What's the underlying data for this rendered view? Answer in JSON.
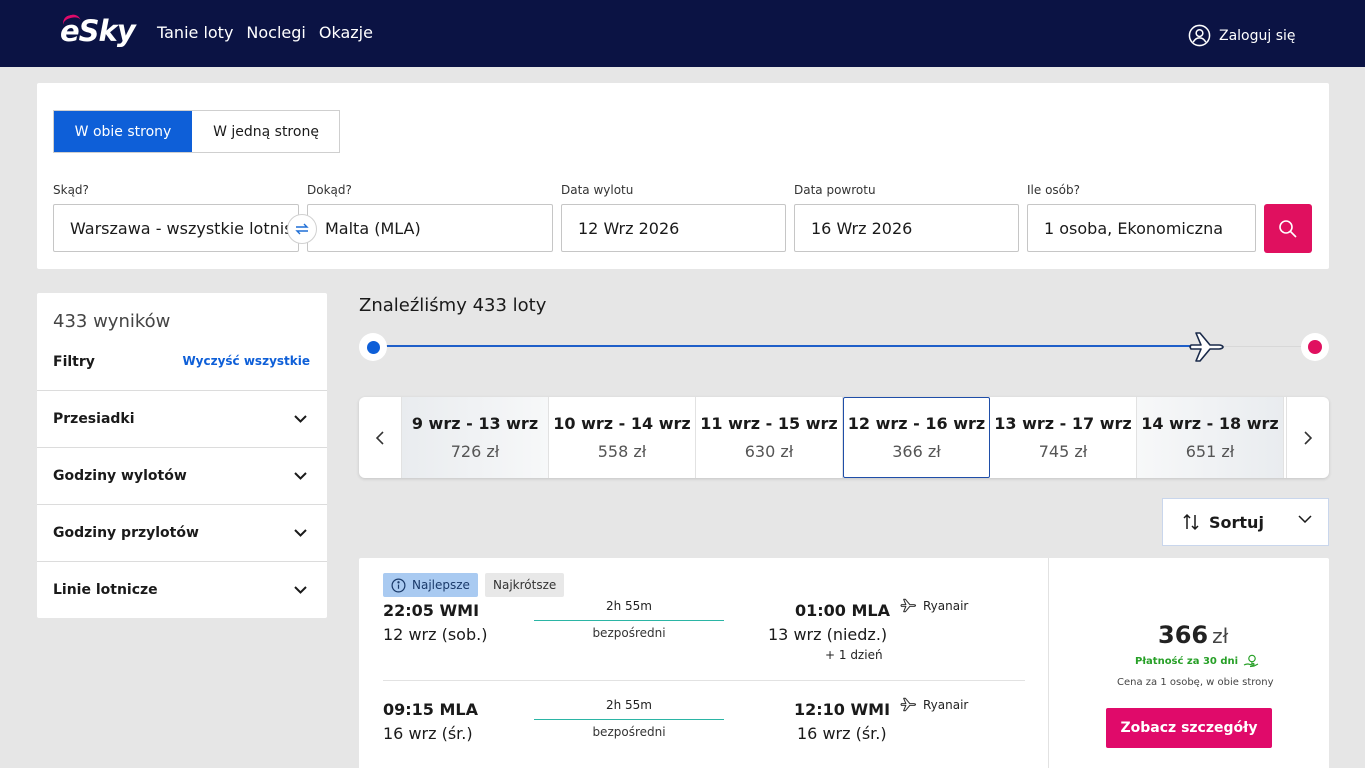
{
  "header": {
    "logo": "eSky",
    "nav": [
      "Tanie loty",
      "Noclegi",
      "Okazje"
    ],
    "login_label": "Zaloguj się"
  },
  "search": {
    "trip_type": {
      "round_trip": "W obie strony",
      "one_way": "W jedną stronę",
      "selected": "W obie strony"
    },
    "from": {
      "label": "Skąd?",
      "value": "Warszawa - wszystkie lotniska"
    },
    "to": {
      "label": "Dokąd?",
      "value": "Malta (MLA)"
    },
    "departure": {
      "label": "Data wylotu",
      "value": "12 Wrz 2026"
    },
    "return": {
      "label": "Data powrotu",
      "value": "16 Wrz 2026"
    },
    "passengers": {
      "label": "Ile osób?",
      "value": "1 osoba, Ekonomiczna"
    }
  },
  "filters": {
    "results_count": "433 wyników",
    "title": "Filtry",
    "clear_all": "Wyczyść wszystkie",
    "sections": [
      "Przesiadki",
      "Godziny wylotów",
      "Godziny przylotów",
      "Linie lotnicze"
    ]
  },
  "results": {
    "title": "Znaleźliśmy 433 loty",
    "date_options": [
      {
        "range": "9 wrz - 13 wrz",
        "price": "726 zł"
      },
      {
        "range": "10 wrz - 14 wrz",
        "price": "558 zł"
      },
      {
        "range": "11 wrz - 15 wrz",
        "price": "630 zł"
      },
      {
        "range": "12 wrz - 16 wrz",
        "price": "366 zł",
        "selected": true
      },
      {
        "range": "13 wrz - 17 wrz",
        "price": "745 zł"
      },
      {
        "range": "14 wrz - 18 wrz",
        "price": "651 zł"
      }
    ],
    "sort_label": "Sortuj"
  },
  "flight": {
    "badges": {
      "best": "Najlepsze",
      "shortest": "Najkrótsze"
    },
    "outbound": {
      "dep_time": "22:05 WMI",
      "dep_date": "12 wrz (sob.)",
      "duration": "2h 55m",
      "stops": "bezpośredni",
      "arr_time": "01:00 MLA",
      "arr_date": "13 wrz (niedz.)",
      "arr_extra": "+ 1 dzień",
      "airline": "Ryanair"
    },
    "inbound": {
      "dep_time": "09:15 MLA",
      "dep_date": "16 wrz (śr.)",
      "duration": "2h 55m",
      "stops": "bezpośredni",
      "arr_time": "12:10 WMI",
      "arr_date": "16 wrz (śr.)",
      "airline": "Ryanair"
    },
    "price": "366",
    "currency": "zł",
    "payment_note": "Płatność za 30 dni",
    "price_note": "Cena za 1 osobę, w obie strony",
    "details_button": "Zobacz szczegóły"
  },
  "colors": {
    "header_bg": "#0b1344",
    "accent_blue": "#0e5fd8",
    "accent_pink": "#e0105f",
    "route_line": "#2bb5a5",
    "pay_green": "#27a027"
  }
}
